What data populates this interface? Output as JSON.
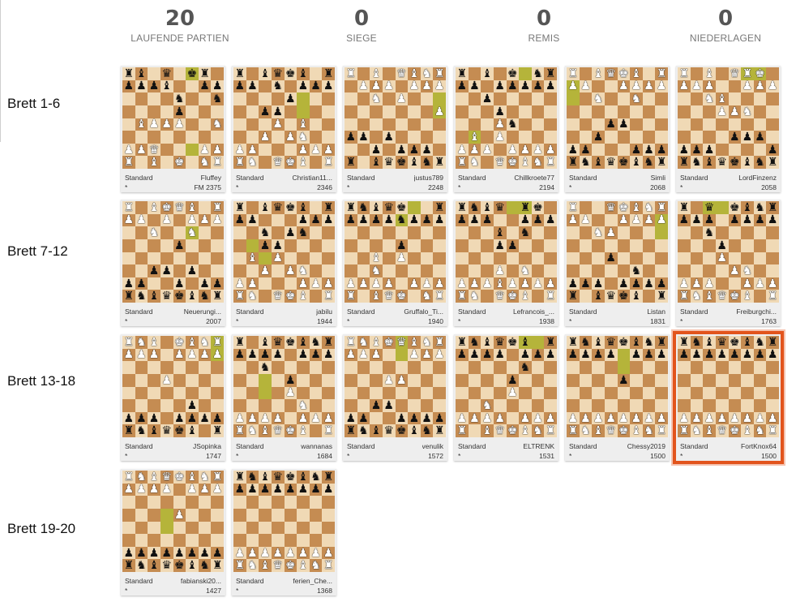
{
  "stats": [
    {
      "value": "20",
      "label": "LAUFENDE PARTIEN"
    },
    {
      "value": "0",
      "label": "SIEGE"
    },
    {
      "value": "0",
      "label": "REMIS"
    },
    {
      "value": "0",
      "label": "NIEDERLAGEN"
    }
  ],
  "row_labels": [
    "Brett 1-6",
    "Brett 7-12",
    "Brett 13-18",
    "Brett 19-20"
  ],
  "colors": {
    "accent": "#e2541c",
    "light_square": "#f0d9b5",
    "dark_square": "#c58c52",
    "last_move": "#b5b43a"
  },
  "boards": [
    {
      "control": "Standard",
      "opponent": "Fluffey",
      "rating": "FM 2375",
      "result": "*",
      "highlight": false,
      "fen": "rb1q1kr1/pppb2pp/4n2n/4p3/1BPPP2N/8/PPQ3PP/R1B1K1NR",
      "marked": [
        [
          0,
          5
        ],
        [
          6,
          5
        ]
      ]
    },
    {
      "control": "Standard",
      "opponent": "Christian11...",
      "rating": "2346",
      "result": "*",
      "highlight": false,
      "fen": "r1bqkb1r/pp1n1ppp/4p3/2pp4/3P1B2/2P1PN2/PP3PPP/RN1QKB1R",
      "marked": [
        [
          2,
          5
        ],
        [
          3,
          5
        ]
      ]
    },
    {
      "control": "Standard",
      "opponent": "justus789",
      "rating": "2248",
      "result": "*",
      "highlight": false,
      "fen": "R1B1QBNR/1PPP1PPP/2N1P3/7P/8/pp1p4/2p1ppp1/r1bqkbnr",
      "marked": [
        [
          2,
          7
        ],
        [
          3,
          7
        ]
      ]
    },
    {
      "control": "Standard",
      "opponent": "Chillkroete77",
      "rating": "2194",
      "result": "*",
      "highlight": false,
      "fen": "r1b1k1nr/pp1ppppp/2p5/3p4/3Pn3/1B1P4/PPP1PPPP/RN1QKBNR",
      "marked": [
        [
          0,
          5
        ],
        [
          5,
          1
        ]
      ]
    },
    {
      "control": "Standard",
      "opponent": "Simli",
      "rating": "2068",
      "result": "*",
      "highlight": false,
      "fen": "R1BQKB1R/PP2PPPP/2N2N2/8/3pp3/2p5/pp3ppp/rnbqkbnr",
      "marked": [
        [
          1,
          0
        ],
        [
          2,
          0
        ]
      ]
    },
    {
      "control": "Standard",
      "opponent": "LordFinzenz",
      "rating": "2058",
      "result": "*",
      "highlight": false,
      "fen": "R1B1QRK1/PPP2PPP/2NB4/3PPN2/8/4ppp1/ppp4p/rnbqkbnr",
      "marked": [
        [
          0,
          5
        ],
        [
          0,
          6
        ]
      ]
    },
    {
      "control": "Standard",
      "opponent": "Neuerungi...",
      "rating": "2007",
      "result": "*",
      "highlight": false,
      "fen": "R1BKQB1R/PP1P1PPP/2N2N2/4p3/8/2pp1p2/pp2p1pp/rnbqkbnr",
      "marked": [
        [
          2,
          5
        ]
      ]
    },
    {
      "control": "Standard",
      "opponent": "jabilu",
      "rating": "1944",
      "result": "*",
      "highlight": false,
      "fen": "r1bqkb1r/pp3ppp/2n1pn2/2pp4/1B1P4/2P1PN2/PP3PPP/RN1QKB1R",
      "marked": [
        [
          3,
          1
        ],
        [
          4,
          2
        ]
      ]
    },
    {
      "control": "Standard",
      "opponent": "Gruffalo_Ti...",
      "rating": "1940",
      "result": "*",
      "highlight": false,
      "fen": "rnbqk2r/ppppnppp/8/4p3/2B1P3/2N5/PPPP1PPP/R1BQK1NR",
      "marked": [
        [
          0,
          5
        ],
        [
          1,
          4
        ]
      ]
    },
    {
      "control": "Standard",
      "opponent": "Lefrancois_...",
      "rating": "1938",
      "result": "*",
      "highlight": false,
      "fen": "rnbq1rk1/ppp2ppp/3b1n2/3pp3/8/3P1N2/PPPBPPPP/RN1QKB1R",
      "marked": [
        [
          0,
          4
        ],
        [
          0,
          5
        ]
      ]
    },
    {
      "control": "Standard",
      "opponent": "Listan",
      "rating": "1831",
      "result": "*",
      "highlight": false,
      "fen": "R2QKBNR/PP2PPPP/2NP4/8/3p4/5n2/ppp1pppp/r1bqkb1r",
      "marked": [
        [
          1,
          7
        ],
        [
          2,
          7
        ]
      ]
    },
    {
      "control": "Standard",
      "opponent": "Freiburgchi...",
      "rating": "1763",
      "result": "*",
      "highlight": false,
      "fen": "r1q1kbnr/ppp1pppp/2n5/3p4/3P4/4PN2/PPP2PPP/RNBQKB1R",
      "marked": [
        [
          0,
          2
        ],
        [
          0,
          3
        ]
      ]
    },
    {
      "control": "Standard",
      "opponent": "JSopinka",
      "rating": "1747",
      "result": "*",
      "highlight": false,
      "fen": "RNB1KBNR/PPP1PPPP/8/3P4/8/5p2/ppp1pppp/rnbqkb1r",
      "marked": [
        [
          0,
          7
        ],
        [
          1,
          7
        ]
      ]
    },
    {
      "control": "Standard",
      "opponent": "wannanas",
      "rating": "1684",
      "result": "*",
      "highlight": false,
      "fen": "r1bqkbnr/pppp1ppp/2n5/4p3/4P3/5N2/PPPP1PPP/RNBQKB1R",
      "marked": [
        [
          3,
          2
        ],
        [
          4,
          2
        ]
      ]
    },
    {
      "control": "Standard",
      "opponent": "venulik",
      "rating": "1572",
      "result": "*",
      "highlight": false,
      "fen": "RNBKQBNR/PPP2PPP/8/3PP3/8/2pp4/pp2pppp/rnbqkbnr",
      "marked": [
        [
          0,
          4
        ],
        [
          1,
          4
        ]
      ]
    },
    {
      "control": "Standard",
      "opponent": "ELTRENK",
      "rating": "1531",
      "result": "*",
      "highlight": false,
      "fen": "rnbqkb1r/pppp1ppp/5n2/4p3/4P3/2N5/PPPP1PPP/R1BQKBNR",
      "marked": [
        [
          0,
          5
        ],
        [
          0,
          6
        ]
      ]
    },
    {
      "control": "Standard",
      "opponent": "Chessy2019",
      "rating": "1500",
      "result": "*",
      "highlight": false,
      "fen": "rnbqkbnr/pppp1ppp/8/4p3/8/8/PPPPPPPP/RNBQKBNR",
      "marked": [
        [
          1,
          4
        ],
        [
          2,
          4
        ]
      ]
    },
    {
      "control": "Standard",
      "opponent": "FortKnox64",
      "rating": "1500",
      "result": "*",
      "highlight": true,
      "fen": "rnbqkbnr/pppppppp/8/8/8/8/PPPPPPPP/RNBQKBNR",
      "marked": []
    },
    {
      "control": "Standard",
      "opponent": "fabianski20...",
      "rating": "1427",
      "result": "*",
      "highlight": false,
      "fen": "RNBQKBNR/PPPP1PPP/8/4P3/8/8/pppppppp/rnbqkbnr",
      "marked": [
        [
          3,
          3
        ],
        [
          4,
          3
        ]
      ]
    },
    {
      "control": "Standard",
      "opponent": "ferien_Che...",
      "rating": "1368",
      "result": "*",
      "highlight": false,
      "fen": "rnbqkbnr/pppppppp/8/8/8/8/PPPPPPPP/RNBQKBNR",
      "marked": []
    }
  ]
}
